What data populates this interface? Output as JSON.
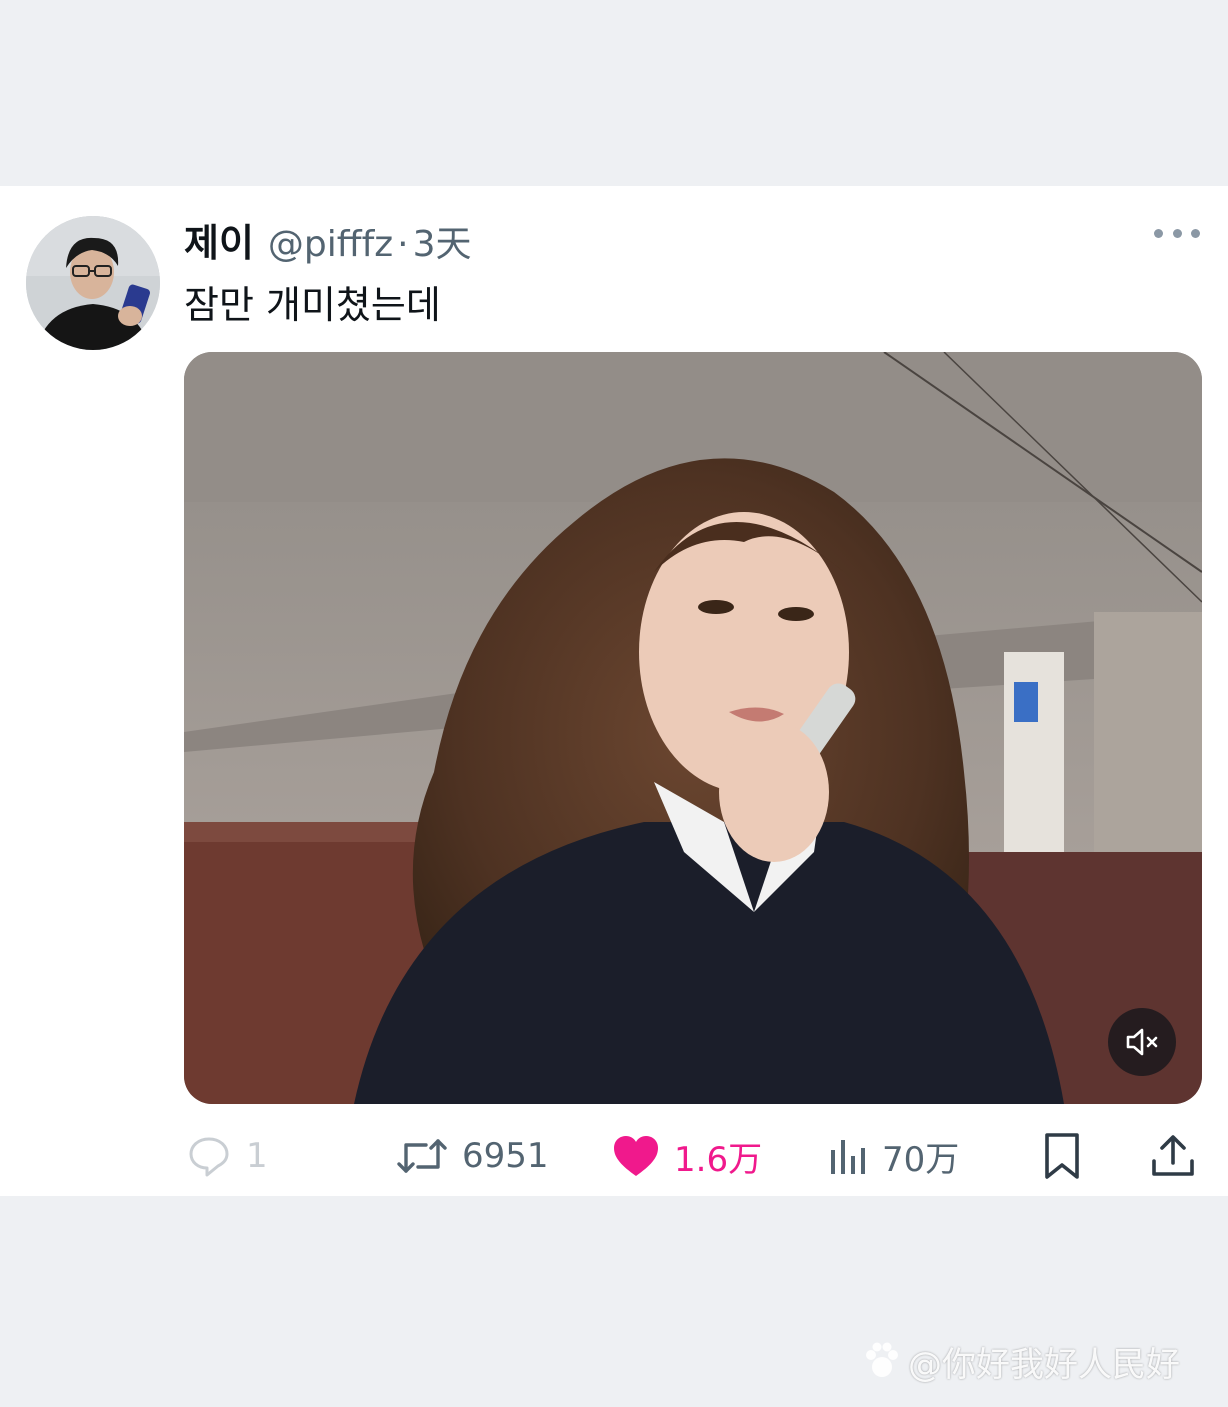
{
  "tweet": {
    "display_name": "제이",
    "handle": "@pifffz",
    "separator": "·",
    "time": "3天",
    "text": "잠만 개미쳤는데"
  },
  "icons": {
    "more": "more-horizontal-icon",
    "mute": "volume-muted-icon",
    "reply": "reply-icon",
    "retweet": "retweet-icon",
    "like": "heart-filled-icon",
    "views": "views-bar-chart-icon",
    "bookmark": "bookmark-icon",
    "share": "share-upload-icon",
    "watermark": "weibo-paw-icon"
  },
  "actions": {
    "reply_count": "1",
    "retweet_count": "6951",
    "like_count": "1.6万",
    "views_count": "70万"
  },
  "colors": {
    "like_active": "#f0198c",
    "muted_text": "#536471",
    "reply_faded": "#c9ced3"
  },
  "watermark": {
    "text": "@你好我好人民好"
  }
}
